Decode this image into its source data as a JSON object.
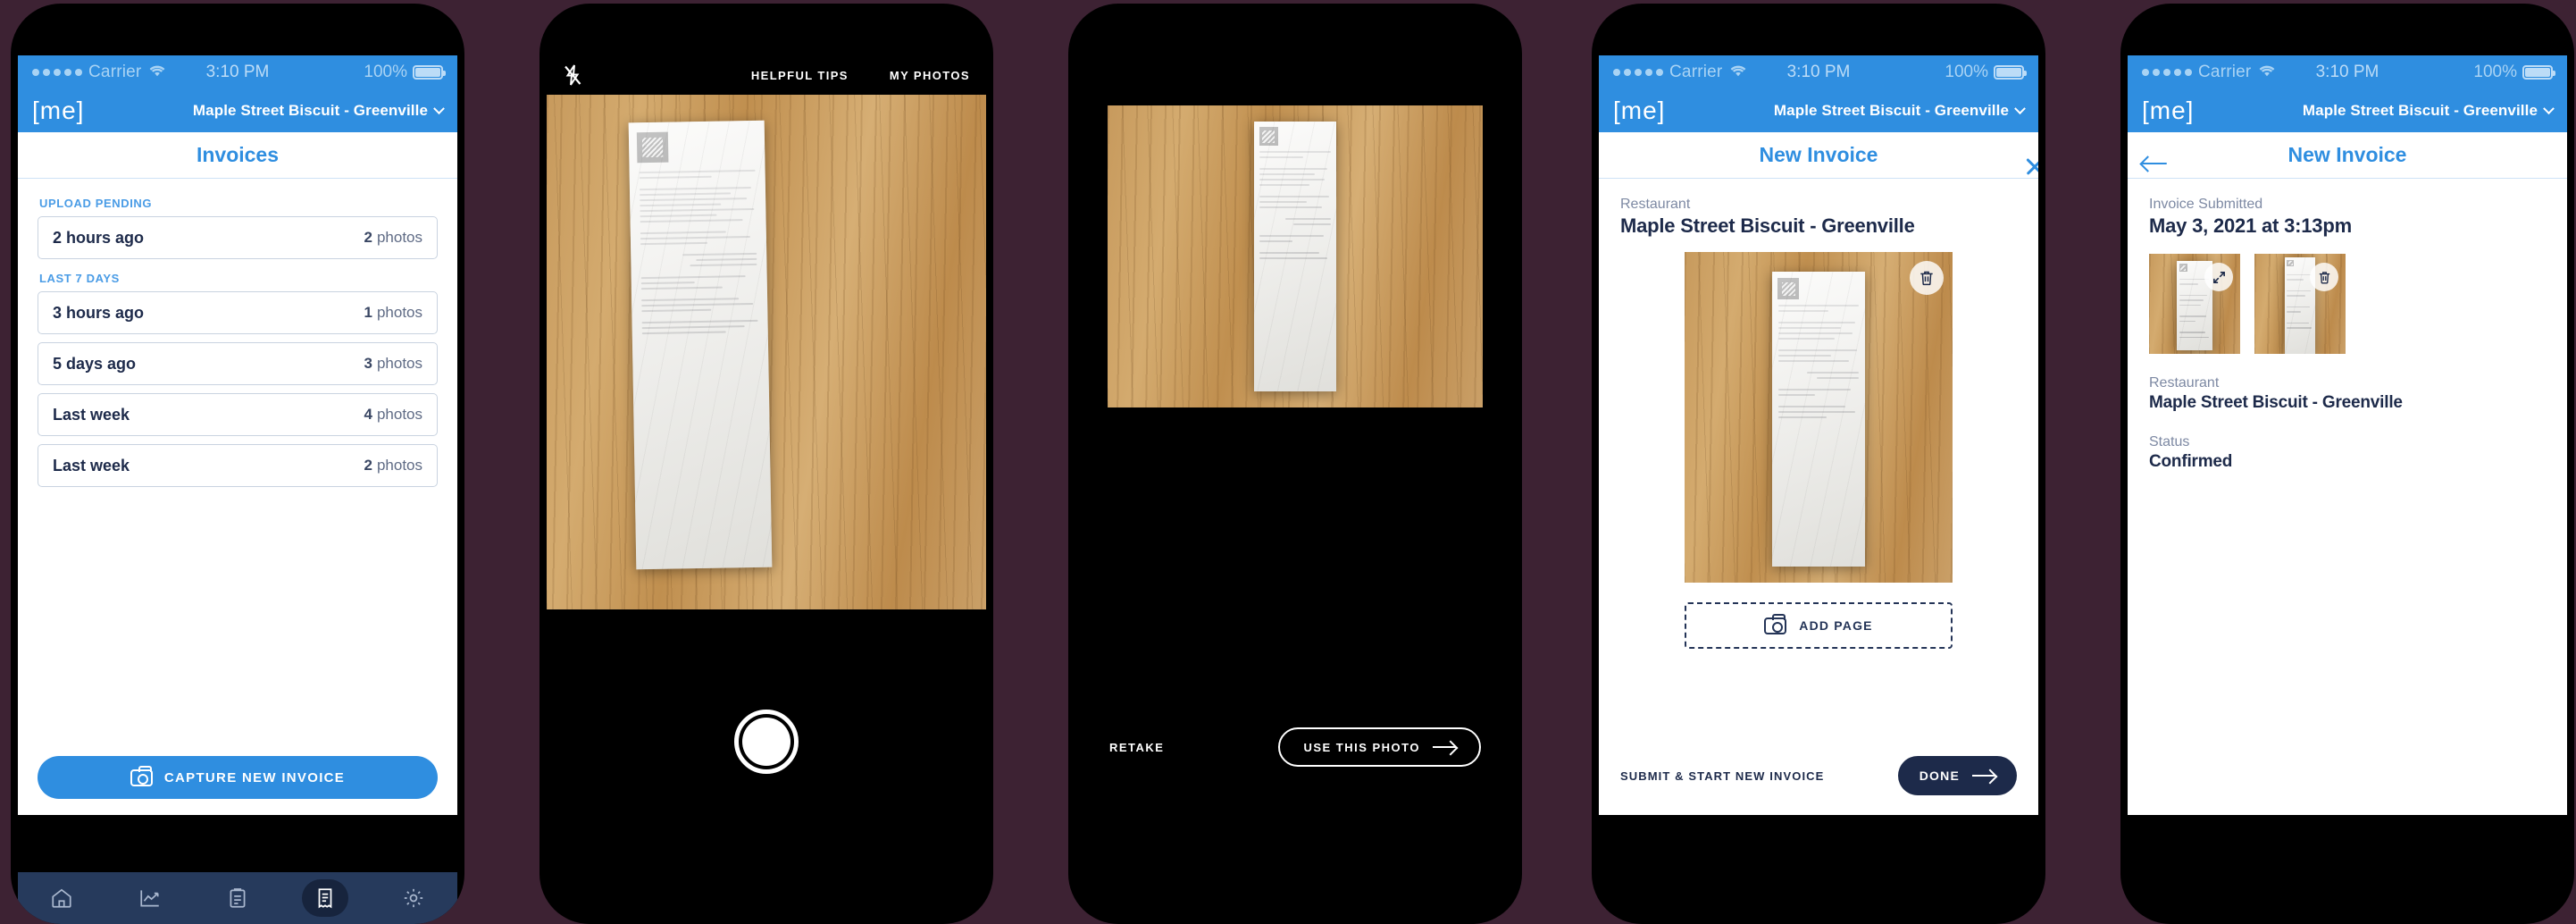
{
  "colors": {
    "background": "#3d2233",
    "accent_blue": "#2f8ee0",
    "navy": "#1d2a4a",
    "tabbar": "#263a5c",
    "tab_active": "#17243d",
    "label_gray": "#7d89a3",
    "border_gray": "#c9d3e0"
  },
  "status_bar": {
    "carrier": "Carrier",
    "time": "3:10 PM",
    "battery": "100%",
    "wifi_icon": "wifi-icon",
    "battery_icon": "battery-full-icon",
    "signal_icon": "signal-dots-icon"
  },
  "app_bar": {
    "brand": "[me]",
    "venue": "Maple Street Biscuit - Greenville",
    "chevron_icon": "chevron-down-icon"
  },
  "screen_invoices": {
    "title": "Invoices",
    "groups": [
      {
        "label": "UPLOAD PENDING",
        "rows": [
          {
            "label": "2 hours ago",
            "count": "2",
            "unit": "photos"
          }
        ]
      },
      {
        "label": "LAST 7 DAYS",
        "rows": [
          {
            "label": "3 hours ago",
            "count": "1",
            "unit": "photos"
          },
          {
            "label": "5 days ago",
            "count": "3",
            "unit": "photos"
          },
          {
            "label": "Last week",
            "count": "4",
            "unit": "photos"
          },
          {
            "label": "Last week",
            "count": "2",
            "unit": "photos"
          }
        ]
      }
    ],
    "cta": {
      "label": "CAPTURE NEW INVOICE",
      "icon": "camera-icon"
    },
    "tabs": [
      {
        "name": "home",
        "icon": "home-icon",
        "active": false
      },
      {
        "name": "analytics",
        "icon": "chart-line-icon",
        "active": false
      },
      {
        "name": "orders",
        "icon": "clipboard-icon",
        "active": false
      },
      {
        "name": "invoices",
        "icon": "receipt-icon",
        "active": true
      },
      {
        "name": "settings",
        "icon": "gear-icon",
        "active": false
      }
    ]
  },
  "screen_camera": {
    "flash_icon": "flash-off-icon",
    "helpful_tips": "HELPFUL TIPS",
    "my_photos": "MY PHOTOS",
    "shutter_icon": "shutter-button-icon"
  },
  "screen_preview": {
    "retake": "RETAKE",
    "use_photo": "USE THIS PHOTO",
    "arrow_icon": "arrow-right-icon"
  },
  "screen_new_invoice": {
    "title": "New Invoice",
    "close_icon": "close-icon",
    "restaurant_label": "Restaurant",
    "restaurant_value": "Maple Street Biscuit - Greenville",
    "delete_icon": "trash-icon",
    "add_page": {
      "label": "ADD PAGE",
      "icon": "camera-icon"
    },
    "submit_link": "SUBMIT & START NEW INVOICE",
    "done": {
      "label": "DONE",
      "icon": "arrow-right-icon"
    }
  },
  "screen_submitted": {
    "title": "New Invoice",
    "back_icon": "back-arrow-icon",
    "submitted_label": "Invoice Submitted",
    "submitted_value": "May 3, 2021 at 3:13pm",
    "thumb_expand_icon": "expand-icon",
    "thumb_delete_icon": "trash-icon",
    "restaurant_label": "Restaurant",
    "restaurant_value": "Maple Street Biscuit - Greenville",
    "status_label": "Status",
    "status_value": "Confirmed"
  },
  "receipt": {
    "brand_logo": "home-depot-logo",
    "tagline_line1": "How doers",
    "tagline_line2": "get more done."
  }
}
